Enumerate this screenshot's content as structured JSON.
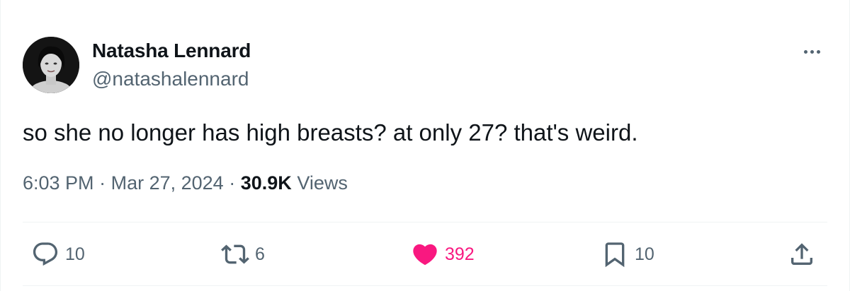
{
  "author": {
    "name": "Natasha Lennard",
    "handle": "@natashalennard",
    "avatar_icon": "profile-photo"
  },
  "tweet": {
    "text": "so she no longer has high breasts? at only 27? that's weird."
  },
  "meta": {
    "time": "6:03 PM",
    "separator": "·",
    "date": "Mar 27, 2024",
    "views_count": "30.9K",
    "views_label": "Views"
  },
  "actions": {
    "reply": {
      "count": "10",
      "icon": "reply-icon"
    },
    "retweet": {
      "count": "6",
      "icon": "retweet-icon"
    },
    "like": {
      "count": "392",
      "icon": "heart-icon",
      "liked": true,
      "color": "#f91880"
    },
    "bookmark": {
      "count": "10",
      "icon": "bookmark-icon"
    },
    "share": {
      "icon": "share-icon"
    }
  },
  "colors": {
    "text_primary": "#0f1419",
    "text_secondary": "#536471",
    "divider": "#eff3f4",
    "like": "#f91880"
  }
}
